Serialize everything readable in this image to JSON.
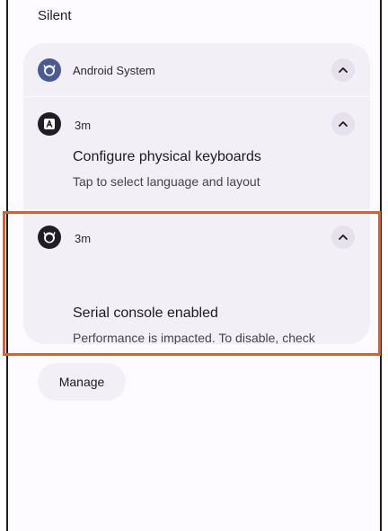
{
  "section": {
    "label": "Silent"
  },
  "group_header": {
    "app_name": "Android System"
  },
  "notifications": [
    {
      "time": "3m",
      "title": "Configure physical keyboards",
      "body": "Tap to select language and layout"
    },
    {
      "time": "3m",
      "title": "Serial console enabled",
      "body": "Performance is impacted. To disable, check bootloader."
    }
  ],
  "footer": {
    "manage_label": "Manage"
  },
  "colors": {
    "highlight": "#f15a11",
    "group_background": "#f3eff7",
    "app_icon_blue": "#4a5a93"
  },
  "icons": {
    "group_app_icon": "android-system-icon",
    "keyboard_icon": "keyboard-a-icon",
    "serial_console_icon": "android-system-icon",
    "expand": "chevron-up-icon"
  }
}
